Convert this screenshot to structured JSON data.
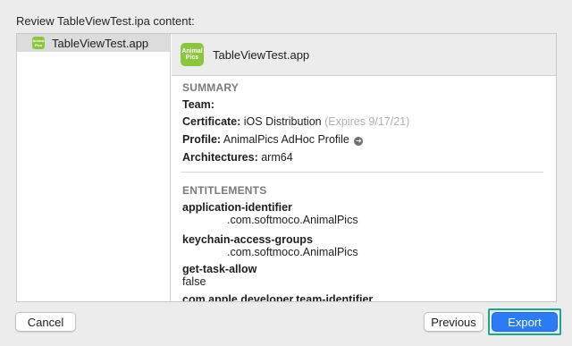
{
  "dialog": {
    "title": "Review TableViewTest.ipa content:"
  },
  "sidebar": {
    "items": [
      {
        "label": "TableViewTest.app",
        "icon_text": "Animal Pics"
      }
    ]
  },
  "detail": {
    "header_title": "TableViewTest.app",
    "icon_text": "Animal Pics",
    "summary": {
      "heading": "SUMMARY",
      "team_label": "Team:",
      "team_value": "",
      "certificate_label": "Certificate:",
      "certificate_value": "iOS Distribution",
      "certificate_expiry": "(Expires 9/17/21)",
      "profile_label": "Profile:",
      "profile_value": "AnimalPics AdHoc Profile",
      "architectures_label": "Architectures:",
      "architectures_value": "arm64"
    },
    "entitlements": {
      "heading": "ENTITLEMENTS",
      "items": [
        {
          "key": "application-identifier",
          "value": ".com.softmoco.AnimalPics"
        },
        {
          "key": "keychain-access-groups",
          "value": ".com.softmoco.AnimalPics"
        },
        {
          "key": "get-task-allow",
          "value": "false"
        },
        {
          "key": "com.apple.developer.team-identifier",
          "value": ""
        }
      ]
    }
  },
  "buttons": {
    "cancel": "Cancel",
    "previous": "Previous",
    "export": "Export"
  },
  "colors": {
    "accent": "#2a7cf6",
    "focus_ring": "#1aa78e",
    "app_icon": "#8cc63f"
  }
}
